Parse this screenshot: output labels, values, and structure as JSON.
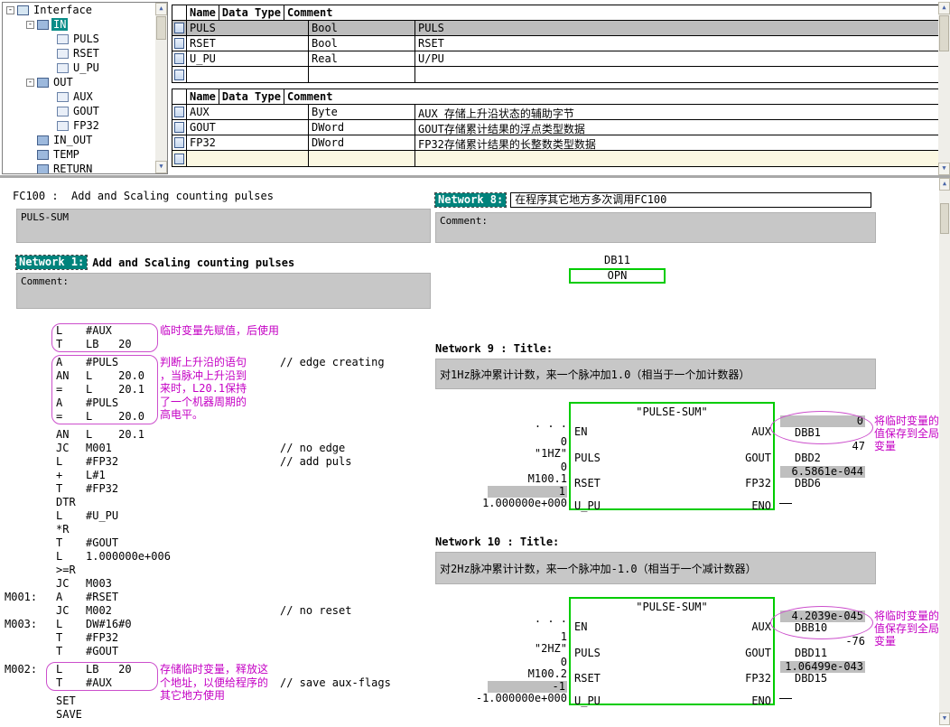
{
  "colors": {
    "teal_network": "#00837c",
    "block_green": "#00cc00",
    "annotation_magenta": "#c400c4",
    "comment_gray": "#c7c7c7",
    "selected_row_gray": "#bcbcbc"
  },
  "icons": {
    "up_arrow": "▲",
    "down_arrow": "▼"
  },
  "tree": {
    "items": [
      {
        "exp": "-",
        "label": "Interface",
        "cls": "lv0",
        "icls": "iface"
      },
      {
        "exp": "-",
        "label": "IN",
        "cls": "lv1",
        "icls": "sect",
        "lcls": "sel"
      },
      {
        "exp": "",
        "label": "PULS",
        "cls": "lv2",
        "icls": "leaf"
      },
      {
        "exp": "",
        "label": "RSET",
        "cls": "lv2",
        "icls": "leaf"
      },
      {
        "exp": "",
        "label": "U_PU",
        "cls": "lv2",
        "icls": "leaf"
      },
      {
        "exp": "-",
        "label": "OUT",
        "cls": "lv1",
        "icls": "sect"
      },
      {
        "exp": "",
        "label": "AUX",
        "cls": "lv2",
        "icls": "leaf"
      },
      {
        "exp": "",
        "label": "GOUT",
        "cls": "lv2",
        "icls": "leaf"
      },
      {
        "exp": "",
        "label": "FP32",
        "cls": "lv2",
        "icls": "leaf"
      },
      {
        "exp": "",
        "label": "IN_OUT",
        "cls": "lv1",
        "icls": "sect"
      },
      {
        "exp": "",
        "label": "TEMP",
        "cls": "lv1",
        "icls": "sect"
      },
      {
        "exp": "",
        "label": "RETURN",
        "cls": "lv1",
        "icls": "sect"
      }
    ]
  },
  "decl_tables": [
    {
      "headers": [
        "Name",
        "Data Type",
        "Comment"
      ],
      "rows": [
        {
          "name": "PULS",
          "type": "Bool",
          "comment": "PULS",
          "cls": "sel"
        },
        {
          "name": "RSET",
          "type": "Bool",
          "comment": "RSET"
        },
        {
          "name": "U_PU",
          "type": "Real",
          "comment": "U/PU"
        },
        {
          "name": "",
          "type": "",
          "comment": ""
        }
      ]
    },
    {
      "headers": [
        "Name",
        "Data Type",
        "Comment"
      ],
      "rows": [
        {
          "name": "AUX",
          "type": "Byte",
          "comment": "AUX 存储上升沿状态的辅助字节"
        },
        {
          "name": "GOUT",
          "type": "DWord",
          "comment": "GOUT存储累计结果的浮点类型数据"
        },
        {
          "name": "FP32",
          "type": "DWord",
          "comment": "FP32存储累计结果的长整数类型数据"
        },
        {
          "name": "",
          "type": "",
          "comment": "",
          "cls": "blank"
        }
      ]
    }
  ],
  "left_editor": {
    "header": "FC100 :  Add and Scaling counting pulses",
    "title_box": "PULS-SUM",
    "network": {
      "label": "Network 1:",
      "title": "Add and Scaling counting pulses"
    },
    "comment_label": "Comment:",
    "groups": [
      {
        "annotation": "临时变量先赋值，后使用",
        "lines": [
          {
            "lbl": "",
            "ins": "L",
            "arg": "#AUX",
            "cmt": ""
          },
          {
            "lbl": "",
            "ins": "T",
            "arg": "LB   20",
            "cmt": ""
          }
        ]
      },
      {
        "annotation": "判断上升沿的语句\n，当脉冲上升沿到\n来时，L20.1保持\n了一个机器周期的\n高电平。",
        "lines": [
          {
            "lbl": "",
            "ins": "A",
            "arg": "#PULS",
            "cmt": "// edge creating"
          },
          {
            "lbl": "",
            "ins": "AN",
            "arg": "L    20.0",
            "cmt": ""
          },
          {
            "lbl": "",
            "ins": "=",
            "arg": "L    20.1",
            "cmt": ""
          },
          {
            "lbl": "",
            "ins": "A",
            "arg": "#PULS",
            "cmt": ""
          },
          {
            "lbl": "",
            "ins": "=",
            "arg": "L    20.0",
            "cmt": ""
          }
        ]
      },
      {
        "annotation": "",
        "lines": [
          {
            "lbl": "",
            "ins": "AN",
            "arg": "L    20.1",
            "cmt": ""
          },
          {
            "lbl": "",
            "ins": "JC",
            "arg": "M001",
            "cmt": "// no edge"
          },
          {
            "lbl": "",
            "ins": "L",
            "arg": "#FP32",
            "cmt": "// add puls"
          },
          {
            "lbl": "",
            "ins": "+",
            "arg": "L#1",
            "cmt": ""
          },
          {
            "lbl": "",
            "ins": "T",
            "arg": "#FP32",
            "cmt": ""
          },
          {
            "lbl": "",
            "ins": "DTR",
            "arg": "",
            "cmt": ""
          },
          {
            "lbl": "",
            "ins": "L",
            "arg": "#U_PU",
            "cmt": ""
          },
          {
            "lbl": "",
            "ins": "*R",
            "arg": "",
            "cmt": ""
          },
          {
            "lbl": "",
            "ins": "T",
            "arg": "#GOUT",
            "cmt": ""
          },
          {
            "lbl": "",
            "ins": "L",
            "arg": "1.000000e+006",
            "cmt": ""
          },
          {
            "lbl": "",
            "ins": ">=R",
            "arg": "",
            "cmt": ""
          },
          {
            "lbl": "",
            "ins": "JC",
            "arg": "M003",
            "cmt": ""
          },
          {
            "lbl": "M001:",
            "ins": "A",
            "arg": "#RSET",
            "cmt": ""
          },
          {
            "lbl": "",
            "ins": "JC",
            "arg": "M002",
            "cmt": "// no reset"
          },
          {
            "lbl": "M003:",
            "ins": "L",
            "arg": "DW#16#0",
            "cmt": ""
          },
          {
            "lbl": "",
            "ins": "T",
            "arg": "#FP32",
            "cmt": ""
          },
          {
            "lbl": "",
            "ins": "T",
            "arg": "#GOUT",
            "cmt": ""
          }
        ]
      },
      {
        "annotation": "存储临时变量，释放这\n个地址，以便给程序的\n其它地方使用",
        "lines": [
          {
            "lbl": "M002:",
            "ins": "L",
            "arg": "LB   20",
            "cmt": ""
          },
          {
            "lbl": "",
            "ins": "T",
            "arg": "#AUX",
            "cmt": "// save aux-flags"
          }
        ]
      },
      {
        "annotation": "",
        "lines": [
          {
            "lbl": "",
            "ins": "SET",
            "arg": "",
            "cmt": ""
          },
          {
            "lbl": "",
            "ins": "SAVE",
            "arg": "",
            "cmt": ""
          }
        ]
      }
    ]
  },
  "right_editor": {
    "network8": {
      "label": "Network 8:",
      "title": "在程序其它地方多次调用FC100"
    },
    "comment_label": "Comment:",
    "db_call": {
      "db": "DB11",
      "op": "OPN"
    },
    "network9": {
      "label": "Network 9",
      "suffix": " : Title:",
      "comment": "对1Hz脉冲累计计数，来一个脉冲加1.0（相当于一个加计数器）"
    },
    "network10": {
      "label": "Network 10",
      "suffix": " : Title:",
      "comment": "对2Hz脉冲累计计数，来一个脉冲加-1.0（相当于一个减计数器）"
    },
    "pins_in": [
      "EN",
      "PULS",
      "RSET",
      "U_PU"
    ],
    "pins_out": [
      "AUX",
      "GOUT",
      "FP32",
      "ENO"
    ],
    "blocks": [
      {
        "title": "\"PULSE-SUM\"",
        "annotation": "将临时变量的\n值保存到全局\n变量",
        "inputs": [
          {
            "val": "",
            "op": ". . ."
          },
          {
            "val": "0",
            "op": "\"1HZ\""
          },
          {
            "val": "0",
            "op": "M100.1"
          },
          {
            "val": "1",
            "op": "1.000000e+000",
            "cls": "bar"
          }
        ],
        "outputs": [
          {
            "val": "0",
            "op": "DBB1",
            "cls": "bar"
          },
          {
            "val": "47",
            "op": "DBD2"
          },
          {
            "val": "6.5861e-044",
            "op": "DBD6",
            "cls": "bar"
          },
          {
            "val": "",
            "op": ""
          }
        ]
      },
      {
        "title": "\"PULSE-SUM\"",
        "annotation": "将临时变量的\n值保存到全局\n变量",
        "inputs": [
          {
            "val": "",
            "op": ". . ."
          },
          {
            "val": "1",
            "op": "\"2HZ\""
          },
          {
            "val": "0",
            "op": "M100.2"
          },
          {
            "val": "-1",
            "op": "-1.000000e+000",
            "cls": "bar"
          }
        ],
        "outputs": [
          {
            "val": "4.2039e-045",
            "op": "DBB10",
            "cls": "bar"
          },
          {
            "val": "-76",
            "op": "DBD11"
          },
          {
            "val": "1.06499e-043",
            "op": "DBD15",
            "cls": "bar"
          },
          {
            "val": "",
            "op": ""
          }
        ]
      }
    ]
  }
}
